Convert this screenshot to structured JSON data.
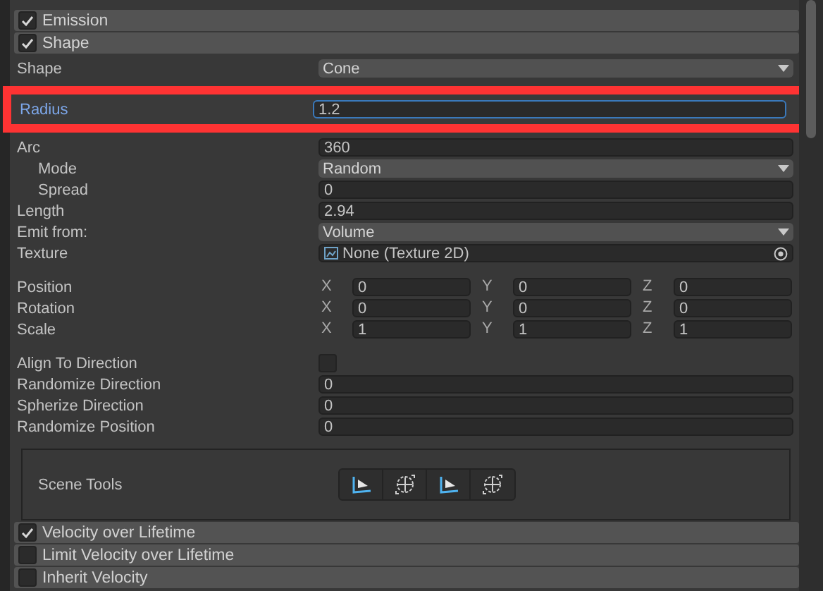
{
  "sections_top": [
    {
      "title": "Emission",
      "checked": true
    },
    {
      "title": "Shape",
      "checked": true
    }
  ],
  "rows": [
    {
      "kind": "dropdown",
      "label": "Shape",
      "value": "Cone"
    },
    {
      "kind": "field",
      "label": "Radius",
      "value": "1.2",
      "focused": true,
      "highlighted": true
    },
    {
      "kind": "field",
      "label": "Arc",
      "value": "360",
      "children": [
        {
          "kind": "dropdown",
          "label": "Mode",
          "value": "Random"
        },
        {
          "kind": "field",
          "label": "Spread",
          "value": "0"
        }
      ]
    },
    {
      "kind": "field",
      "label": "Length",
      "value": "2.94"
    },
    {
      "kind": "dropdown",
      "label": "Emit from:",
      "value": "Volume"
    },
    {
      "kind": "texture",
      "label": "Texture",
      "value": "None (Texture 2D)"
    },
    {
      "kind": "gap"
    },
    {
      "kind": "vector",
      "label": "Position",
      "axes": [
        {
          "axis": "X",
          "value": "0"
        },
        {
          "axis": "Y",
          "value": "0"
        },
        {
          "axis": "Z",
          "value": "0"
        }
      ]
    },
    {
      "kind": "vector",
      "label": "Rotation",
      "axes": [
        {
          "axis": "X",
          "value": "0"
        },
        {
          "axis": "Y",
          "value": "0"
        },
        {
          "axis": "Z",
          "value": "0"
        }
      ]
    },
    {
      "kind": "vector",
      "label": "Scale",
      "axes": [
        {
          "axis": "X",
          "value": "1"
        },
        {
          "axis": "Y",
          "value": "1"
        },
        {
          "axis": "Z",
          "value": "1"
        }
      ]
    },
    {
      "kind": "gap"
    },
    {
      "kind": "checkbox",
      "label": "Align To Direction",
      "checked": false
    },
    {
      "kind": "field",
      "label": "Randomize Direction",
      "value": "0"
    },
    {
      "kind": "field",
      "label": "Spherize Direction",
      "value": "0"
    },
    {
      "kind": "field",
      "label": "Randomize Position",
      "value": "0"
    }
  ],
  "scene_tools": {
    "label": "Scene Tools",
    "tools": [
      {
        "kind": "shape"
      },
      {
        "kind": "transform"
      },
      {
        "kind": "shape"
      },
      {
        "kind": "transform"
      }
    ]
  },
  "sections_bottom": [
    {
      "title": "Velocity over Lifetime",
      "checked": true
    },
    {
      "title": "Limit Velocity over Lifetime",
      "checked": false
    },
    {
      "title": "Inherit Velocity",
      "checked": false
    }
  ]
}
